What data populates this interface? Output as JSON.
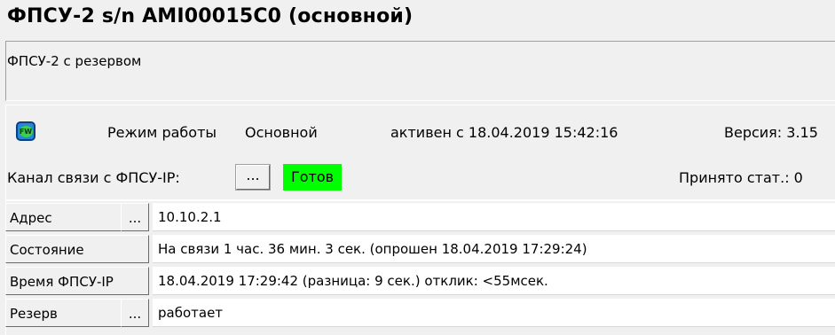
{
  "window": {
    "title": "ФПСУ-2 s/n AMI00015C0 (основной)",
    "description": "ФПСУ-2 с резервом"
  },
  "status_row": {
    "icon": "fw-icon",
    "mode_label": "Режим работы",
    "mode_value": "Основной",
    "active_since": "активен с 18.04.2019 15:42:16",
    "version": "Версия: 3.15"
  },
  "channel_row": {
    "label": "Канал связи с ФПСУ-IP:",
    "button_label": "...",
    "status_text": "Готов",
    "status_color": "#00ff00",
    "received": "Принято стат.: 0"
  },
  "properties": [
    {
      "label": "Адрес",
      "has_button": true,
      "button_label": "...",
      "value": "10.10.2.1"
    },
    {
      "label": "Состояние",
      "has_button": false,
      "value": "На связи  1 час.  36 мин. 3 сек.   (опрошен 18.04.2019 17:29:24)"
    },
    {
      "label": "Время ФПСУ-IP",
      "has_button": false,
      "value": "18.04.2019 17:29:42  (разница: 9 сек.) отклик: <55мсек."
    },
    {
      "label": "Резерв",
      "has_button": true,
      "button_label": "...",
      "value": "работает"
    }
  ]
}
